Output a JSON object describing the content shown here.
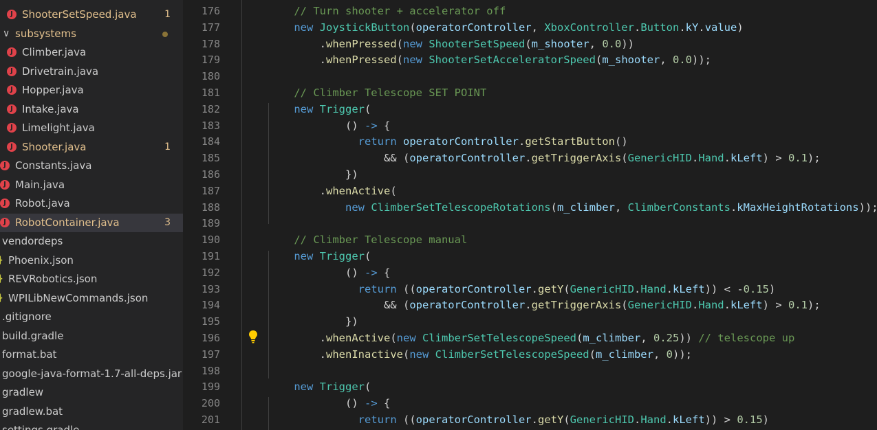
{
  "explorer": {
    "items": [
      {
        "label": "ShooterSetSpeed.java",
        "type": "java",
        "indent": 32,
        "badge": "1",
        "modified": true
      },
      {
        "label": "subsystems",
        "type": "folder",
        "indent": 22,
        "dot": true,
        "modified": true
      },
      {
        "label": "Climber.java",
        "type": "java",
        "indent": 32
      },
      {
        "label": "Drivetrain.java",
        "type": "java",
        "indent": 32
      },
      {
        "label": "Hopper.java",
        "type": "java",
        "indent": 32
      },
      {
        "label": "Intake.java",
        "type": "java",
        "indent": 32
      },
      {
        "label": "Limelight.java",
        "type": "java",
        "indent": 32
      },
      {
        "label": "Shooter.java",
        "type": "java",
        "indent": 32,
        "badge": "1",
        "modified": true
      },
      {
        "label": "Constants.java",
        "type": "java",
        "indent": 22
      },
      {
        "label": "Main.java",
        "type": "java",
        "indent": 22
      },
      {
        "label": "Robot.java",
        "type": "java",
        "indent": 22
      },
      {
        "label": "RobotContainer.java",
        "type": "java",
        "indent": 22,
        "badge": "3",
        "modified": true,
        "selected": true
      },
      {
        "label": "vendordeps",
        "type": "plain",
        "indent": 3
      },
      {
        "label": "Phoenix.json",
        "type": "json",
        "indent": 12
      },
      {
        "label": "REVRobotics.json",
        "type": "json",
        "indent": 12
      },
      {
        "label": "WPILibNewCommands.json",
        "type": "json",
        "indent": 12
      },
      {
        "label": ".gitignore",
        "type": "plain",
        "indent": 3
      },
      {
        "label": "build.gradle",
        "type": "plain",
        "indent": 3
      },
      {
        "label": "format.bat",
        "type": "plain",
        "indent": 3
      },
      {
        "label": "google-java-format-1.7-all-deps.jar",
        "type": "plain",
        "indent": 3
      },
      {
        "label": "gradlew",
        "type": "plain",
        "indent": 3
      },
      {
        "label": "gradlew.bat",
        "type": "plain",
        "indent": 3
      },
      {
        "label": "settings.gradle",
        "type": "plain",
        "indent": 3
      }
    ]
  },
  "colors": {
    "keyword": "#569cd6",
    "type": "#4ec9b0",
    "func": "#dcdcaa",
    "var": "#9cdcfe",
    "num": "#b5cea8",
    "comment": "#6a9955",
    "plain": "#d4d4d4",
    "const": "#4fc1ff",
    "lineNumber": "#858585",
    "modified": "#e2c08d",
    "javaIcon": "#e0424a",
    "jsonIcon": "#cbcb41",
    "bulb": "#ffcc00"
  },
  "editor": {
    "lines": [
      {
        "n": "176",
        "t": [
          [
            "    ",
            "p"
          ],
          [
            "// Turn shooter + accelerator off",
            "c"
          ]
        ]
      },
      {
        "n": "177",
        "t": [
          [
            "    ",
            "p"
          ],
          [
            "new",
            "k"
          ],
          [
            " ",
            "p"
          ],
          [
            "JoystickButton",
            "t"
          ],
          [
            "(",
            "p"
          ],
          [
            "operatorController",
            "v"
          ],
          [
            ", ",
            "p"
          ],
          [
            "XboxController",
            "t"
          ],
          [
            ".",
            "p"
          ],
          [
            "Button",
            "t"
          ],
          [
            ".",
            "p"
          ],
          [
            "kY",
            "v"
          ],
          [
            ".",
            "p"
          ],
          [
            "value",
            "v"
          ],
          [
            ")",
            "p"
          ]
        ]
      },
      {
        "n": "178",
        "t": [
          [
            "        .",
            "p"
          ],
          [
            "whenPressed",
            "f"
          ],
          [
            "(",
            "p"
          ],
          [
            "new",
            "k"
          ],
          [
            " ",
            "p"
          ],
          [
            "ShooterSetSpeed",
            "t"
          ],
          [
            "(",
            "p"
          ],
          [
            "m_shooter",
            "v"
          ],
          [
            ", ",
            "p"
          ],
          [
            "0.0",
            "n"
          ],
          [
            "))",
            "p"
          ]
        ]
      },
      {
        "n": "179",
        "t": [
          [
            "        .",
            "p"
          ],
          [
            "whenPressed",
            "f"
          ],
          [
            "(",
            "p"
          ],
          [
            "new",
            "k"
          ],
          [
            " ",
            "p"
          ],
          [
            "ShooterSetAcceleratorSpeed",
            "t"
          ],
          [
            "(",
            "p"
          ],
          [
            "m_shooter",
            "v"
          ],
          [
            ", ",
            "p"
          ],
          [
            "0.0",
            "n"
          ],
          [
            "));",
            "p"
          ]
        ]
      },
      {
        "n": "180",
        "t": []
      },
      {
        "n": "181",
        "t": [
          [
            "    ",
            "p"
          ],
          [
            "// Climber Telescope SET POINT",
            "c"
          ]
        ]
      },
      {
        "n": "182",
        "t": [
          [
            "    ",
            "p"
          ],
          [
            "new",
            "k"
          ],
          [
            " ",
            "p"
          ],
          [
            "Trigger",
            "t"
          ],
          [
            "(",
            "p"
          ]
        ]
      },
      {
        "n": "183",
        "t": [
          [
            "            () ",
            "p"
          ],
          [
            "->",
            "k"
          ],
          [
            " {",
            "p"
          ]
        ]
      },
      {
        "n": "184",
        "t": [
          [
            "              ",
            "p"
          ],
          [
            "return",
            "k"
          ],
          [
            " ",
            "p"
          ],
          [
            "operatorController",
            "v"
          ],
          [
            ".",
            "p"
          ],
          [
            "getStartButton",
            "f"
          ],
          [
            "()",
            "p"
          ]
        ]
      },
      {
        "n": "185",
        "t": [
          [
            "                  && (",
            "p"
          ],
          [
            "operatorController",
            "v"
          ],
          [
            ".",
            "p"
          ],
          [
            "getTriggerAxis",
            "f"
          ],
          [
            "(",
            "p"
          ],
          [
            "GenericHID",
            "t"
          ],
          [
            ".",
            "p"
          ],
          [
            "Hand",
            "t"
          ],
          [
            ".",
            "p"
          ],
          [
            "kLeft",
            "v"
          ],
          [
            ") > ",
            "p"
          ],
          [
            "0.1",
            "n"
          ],
          [
            ");",
            "p"
          ]
        ]
      },
      {
        "n": "186",
        "t": [
          [
            "            })",
            "p"
          ]
        ]
      },
      {
        "n": "187",
        "t": [
          [
            "        .",
            "p"
          ],
          [
            "whenActive",
            "f"
          ],
          [
            "(",
            "p"
          ]
        ]
      },
      {
        "n": "188",
        "t": [
          [
            "            ",
            "p"
          ],
          [
            "new",
            "k"
          ],
          [
            " ",
            "p"
          ],
          [
            "ClimberSetTelescopeRotations",
            "t"
          ],
          [
            "(",
            "p"
          ],
          [
            "m_climber",
            "v"
          ],
          [
            ", ",
            "p"
          ],
          [
            "ClimberConstants",
            "t"
          ],
          [
            ".",
            "p"
          ],
          [
            "kMaxHeightRotations",
            "v"
          ],
          [
            "));",
            "p"
          ]
        ]
      },
      {
        "n": "189",
        "t": []
      },
      {
        "n": "190",
        "t": [
          [
            "    ",
            "p"
          ],
          [
            "// Climber Telescope manual",
            "c"
          ]
        ]
      },
      {
        "n": "191",
        "t": [
          [
            "    ",
            "p"
          ],
          [
            "new",
            "k"
          ],
          [
            " ",
            "p"
          ],
          [
            "Trigger",
            "t"
          ],
          [
            "(",
            "p"
          ]
        ]
      },
      {
        "n": "192",
        "t": [
          [
            "            () ",
            "p"
          ],
          [
            "->",
            "k"
          ],
          [
            " {",
            "p"
          ]
        ]
      },
      {
        "n": "193",
        "t": [
          [
            "              ",
            "p"
          ],
          [
            "return",
            "k"
          ],
          [
            " ((",
            "p"
          ],
          [
            "operatorController",
            "v"
          ],
          [
            ".",
            "p"
          ],
          [
            "getY",
            "f"
          ],
          [
            "(",
            "p"
          ],
          [
            "GenericHID",
            "t"
          ],
          [
            ".",
            "p"
          ],
          [
            "Hand",
            "t"
          ],
          [
            ".",
            "p"
          ],
          [
            "kLeft",
            "v"
          ],
          [
            ")) < -",
            "p"
          ],
          [
            "0.15",
            "n"
          ],
          [
            ")",
            "p"
          ]
        ]
      },
      {
        "n": "194",
        "t": [
          [
            "                  && (",
            "p"
          ],
          [
            "operatorController",
            "v"
          ],
          [
            ".",
            "p"
          ],
          [
            "getTriggerAxis",
            "f"
          ],
          [
            "(",
            "p"
          ],
          [
            "GenericHID",
            "t"
          ],
          [
            ".",
            "p"
          ],
          [
            "Hand",
            "t"
          ],
          [
            ".",
            "p"
          ],
          [
            "kLeft",
            "v"
          ],
          [
            ") > ",
            "p"
          ],
          [
            "0.1",
            "n"
          ],
          [
            ");",
            "p"
          ]
        ]
      },
      {
        "n": "195",
        "t": [
          [
            "            })",
            "p"
          ]
        ]
      },
      {
        "n": "196",
        "t": [
          [
            "        .",
            "p"
          ],
          [
            "whenActive",
            "f"
          ],
          [
            "(",
            "p"
          ],
          [
            "new",
            "k"
          ],
          [
            " ",
            "p"
          ],
          [
            "ClimberSetTelescopeSpeed",
            "t"
          ],
          [
            "(",
            "p"
          ],
          [
            "m_climber",
            "v"
          ],
          [
            ", ",
            "p"
          ],
          [
            "0.25",
            "n"
          ],
          [
            ")) ",
            "p"
          ],
          [
            "// telescope up",
            "c"
          ]
        ]
      },
      {
        "n": "197",
        "t": [
          [
            "        .",
            "p"
          ],
          [
            "whenInactive",
            "f"
          ],
          [
            "(",
            "p"
          ],
          [
            "new",
            "k"
          ],
          [
            " ",
            "p"
          ],
          [
            "ClimberSetTelescopeSpeed",
            "t"
          ],
          [
            "(",
            "p"
          ],
          [
            "m_climber",
            "v"
          ],
          [
            ", ",
            "p"
          ],
          [
            "0",
            "n"
          ],
          [
            "));",
            "p"
          ]
        ]
      },
      {
        "n": "198",
        "t": []
      },
      {
        "n": "199",
        "t": [
          [
            "    ",
            "p"
          ],
          [
            "new",
            "k"
          ],
          [
            " ",
            "p"
          ],
          [
            "Trigger",
            "t"
          ],
          [
            "(",
            "p"
          ]
        ]
      },
      {
        "n": "200",
        "t": [
          [
            "            () ",
            "p"
          ],
          [
            "->",
            "k"
          ],
          [
            " {",
            "p"
          ]
        ]
      },
      {
        "n": "201",
        "t": [
          [
            "              ",
            "p"
          ],
          [
            "return",
            "k"
          ],
          [
            " ((",
            "p"
          ],
          [
            "operatorController",
            "v"
          ],
          [
            ".",
            "p"
          ],
          [
            "getY",
            "f"
          ],
          [
            "(",
            "p"
          ],
          [
            "GenericHID",
            "t"
          ],
          [
            ".",
            "p"
          ],
          [
            "Hand",
            "t"
          ],
          [
            ".",
            "p"
          ],
          [
            "kLeft",
            "v"
          ],
          [
            ")) > ",
            "p"
          ],
          [
            "0.15",
            "n"
          ],
          [
            ")",
            "p"
          ]
        ]
      }
    ]
  }
}
